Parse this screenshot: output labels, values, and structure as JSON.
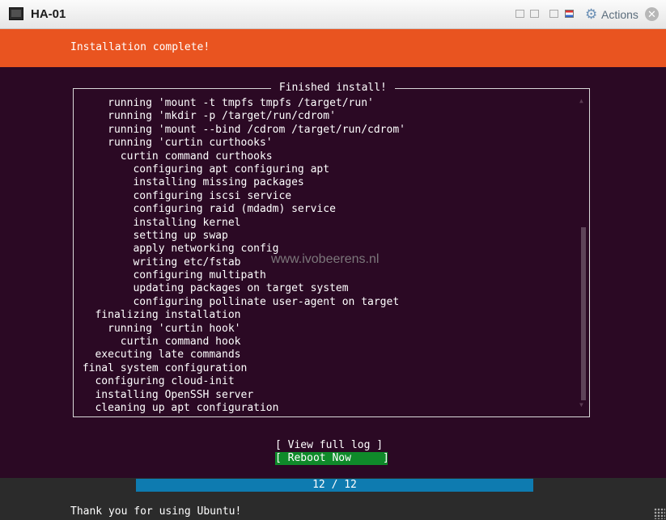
{
  "window": {
    "title": "HA-01",
    "actions_label": "Actions",
    "icons": [
      "vm-console-icon",
      "minimize-icon",
      "restore-icon",
      "maximize-icon",
      "flag-icon",
      "gear-icon",
      "close-icon"
    ]
  },
  "header": {
    "text": "Installation complete!",
    "color": "#e95420"
  },
  "log": {
    "title": " Finished install! ",
    "lines": [
      "     running 'mount -t tmpfs tmpfs /target/run'",
      "     running 'mkdir -p /target/run/cdrom'",
      "     running 'mount --bind /cdrom /target/run/cdrom'",
      "     running 'curtin curthooks'",
      "       curtin command curthooks",
      "         configuring apt configuring apt",
      "         installing missing packages",
      "         configuring iscsi service",
      "         configuring raid (mdadm) service",
      "         installing kernel",
      "         setting up swap",
      "         apply networking config",
      "         writing etc/fstab",
      "         configuring multipath",
      "         updating packages on target system",
      "         configuring pollinate user-agent on target",
      "   finalizing installation",
      "     running 'curtin hook'",
      "       curtin command hook",
      "   executing late commands",
      " final system configuration",
      "   configuring cloud-init",
      "   installing OpenSSH server",
      "   cleaning up apt configuration"
    ],
    "scroll_position": 0.75
  },
  "buttons": {
    "view_log": "[ View full log ]",
    "reboot": "[ Reboot Now     ]"
  },
  "progress": {
    "current": 12,
    "total": 12,
    "text": "12 / 12",
    "fraction": 1.0
  },
  "footer": {
    "text": "Thank you for using Ubuntu!"
  },
  "watermark": "www.ivobeerens.nl"
}
